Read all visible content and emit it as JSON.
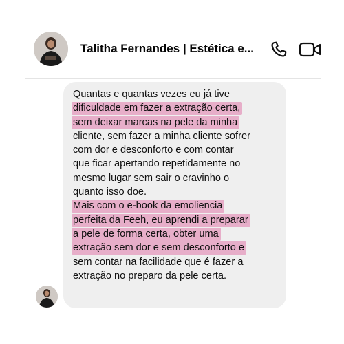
{
  "header": {
    "contact_name": "Talitha Fernandes | Estética e...",
    "avatar_icon": "profile-photo",
    "call_icon": "phone-icon",
    "video_icon": "video-camera-icon"
  },
  "message": {
    "lines": [
      {
        "text": "Quantas e quantas vezes eu já tive",
        "highlighted": false
      },
      {
        "text": "dificuldade em fazer a extração certa,",
        "highlighted": true
      },
      {
        "text": "sem deixar marcas na pele da minha",
        "highlighted": true
      },
      {
        "text": "cliente, sem fazer a minha cliente sofrer",
        "highlighted": false
      },
      {
        "text": "com dor e desconforto e com contar",
        "highlighted": false
      },
      {
        "text": "que ficar apertando repetidamente no",
        "highlighted": false
      },
      {
        "text": "mesmo lugar sem sair o cravinho o",
        "highlighted": false
      },
      {
        "text": "quanto isso doe.",
        "highlighted": false
      },
      {
        "text": "Mais com o e-book da emoliencia",
        "highlighted": true
      },
      {
        "text": "perfeita da Feeh, eu aprendi a preparar",
        "highlighted": true
      },
      {
        "text": "a pele de forma certa, obter uma",
        "highlighted": true
      },
      {
        "text": "extração sem dor e sem desconforto e",
        "highlighted": true
      },
      {
        "text": "sem contar na facilidade que é fazer a",
        "highlighted": false
      },
      {
        "text": "extração no preparo da pele certa.",
        "highlighted": false
      }
    ]
  },
  "colors": {
    "highlight": "#e078aa",
    "bubble": "#efefef",
    "text": "#111111"
  }
}
